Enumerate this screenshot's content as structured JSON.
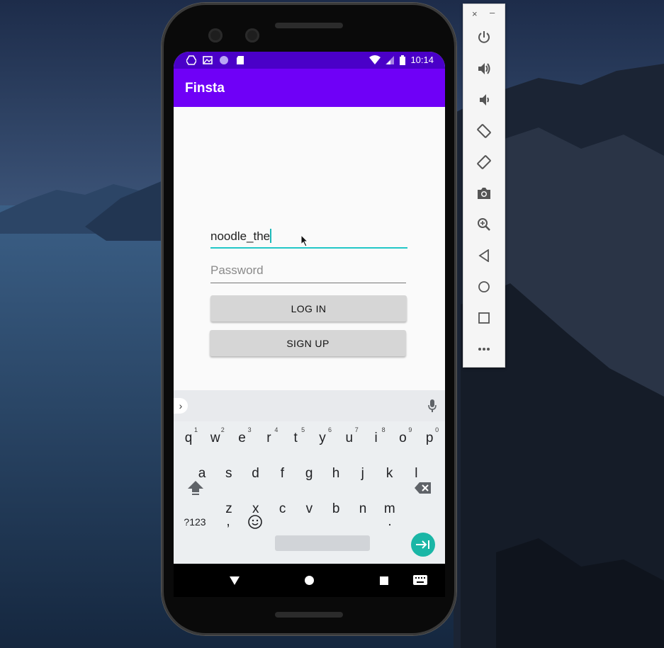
{
  "app": {
    "title": "Finsta",
    "status_time": "10:14"
  },
  "login_form": {
    "username_value": "noodle_the",
    "password_placeholder": "Password",
    "login_label": "LOG IN",
    "signup_label": "SIGN UP"
  },
  "keyboard": {
    "row1": [
      {
        "k": "q",
        "h": "1"
      },
      {
        "k": "w",
        "h": "2"
      },
      {
        "k": "e",
        "h": "3"
      },
      {
        "k": "r",
        "h": "4"
      },
      {
        "k": "t",
        "h": "5"
      },
      {
        "k": "y",
        "h": "6"
      },
      {
        "k": "u",
        "h": "7"
      },
      {
        "k": "i",
        "h": "8"
      },
      {
        "k": "o",
        "h": "9"
      },
      {
        "k": "p",
        "h": "0"
      }
    ],
    "row2": [
      "a",
      "s",
      "d",
      "f",
      "g",
      "h",
      "j",
      "k",
      "l"
    ],
    "row3": [
      "z",
      "x",
      "c",
      "v",
      "b",
      "n",
      "m"
    ],
    "symbols_label": "?123",
    "comma_label": ",",
    "period_label": "."
  },
  "colors": {
    "status_bar": "#4a00c8",
    "app_bar": "#6f00f7",
    "accent": "#22c7c7",
    "enter_key": "#1ab6a6"
  },
  "emulator_panel": {
    "close_label": "×",
    "minimize_label": "–",
    "icons": [
      "power-icon",
      "volume-up-icon",
      "volume-down-icon",
      "rotate-left-icon",
      "rotate-right-icon",
      "camera-icon",
      "zoom-icon",
      "back-icon",
      "home-icon",
      "overview-icon",
      "more-icon"
    ]
  }
}
